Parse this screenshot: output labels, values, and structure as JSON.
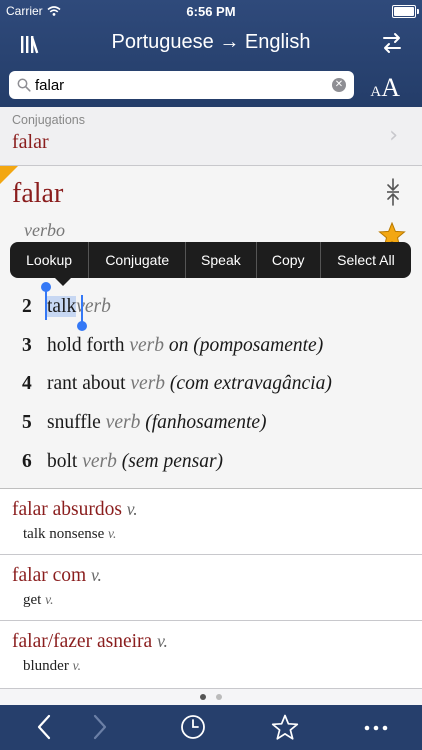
{
  "status_bar": {
    "carrier": "Carrier",
    "time": "6:56 PM"
  },
  "nav": {
    "title": "Portuguese → English",
    "library_icon": "library-icon",
    "swap_icon": "swap-direction-icon"
  },
  "search": {
    "value": "falar",
    "placeholder": ""
  },
  "text_size": {
    "small": "A",
    "big": "A"
  },
  "conjugations": {
    "label": "Conjugations",
    "word": "falar"
  },
  "entry": {
    "headword": "falar",
    "part_of_speech": "verbo",
    "senses": [
      {
        "num": "2",
        "pre": "",
        "sel": "talk",
        "text": "",
        "gram": "verb",
        "note": ""
      },
      {
        "num": "3",
        "pre": "",
        "sel": "",
        "text": "hold forth",
        "gram": "verb",
        "note": "on (pomposamente)"
      },
      {
        "num": "4",
        "pre": "",
        "sel": "",
        "text": "rant about",
        "gram": "verb",
        "note": "(com extravagância)"
      },
      {
        "num": "5",
        "pre": "",
        "sel": "",
        "text": "snuffle",
        "gram": "verb",
        "note": "(fanhosamente)"
      },
      {
        "num": "6",
        "pre": "",
        "sel": "",
        "text": "bolt",
        "gram": "verb",
        "note": "(sem pensar)"
      }
    ]
  },
  "context_menu": [
    "Lookup",
    "Conjugate",
    "Speak",
    "Copy",
    "Select All"
  ],
  "phrases": [
    {
      "phrase": "falar absurdos",
      "pos": "v.",
      "translation": "talk nonsense",
      "tpos": "v."
    },
    {
      "phrase": "falar com",
      "pos": "v.",
      "translation": "get",
      "tpos": "v."
    },
    {
      "phrase": "falar/fazer asneira",
      "pos": "v.",
      "translation": "blunder",
      "tpos": "v."
    }
  ],
  "pager": {
    "pages": 2,
    "current": 1
  },
  "toolbar": [
    "back-arrow-icon",
    "forward-arrow-icon",
    "history-clock-icon",
    "favorites-star-icon",
    "more-icon"
  ],
  "colors": {
    "nav": "#2f4a7b",
    "headword": "#8a1d1d",
    "selection": "#c7d7f2",
    "handle": "#3478f6",
    "star": "#f3a712"
  }
}
